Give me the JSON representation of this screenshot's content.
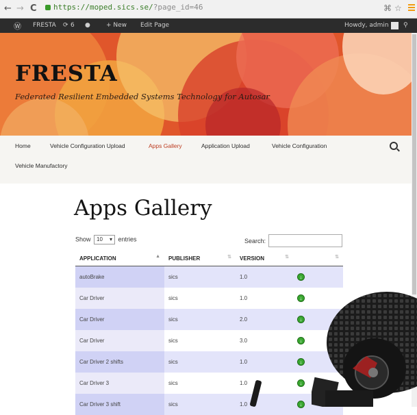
{
  "browser": {
    "back": "←",
    "forward": "→",
    "reload": "C",
    "url_host": "https://moped.sics.se/",
    "url_path": "?page_id=46"
  },
  "adminbar": {
    "site": "FRESTA",
    "updates": "6",
    "new": "+ New",
    "edit_page": "Edit Page",
    "greeting": "Howdy, admin"
  },
  "header": {
    "title": "FRESTA",
    "tagline": "Federated Resilient Embedded Systems Technology for Autosar"
  },
  "nav": {
    "items": [
      {
        "label": "Home"
      },
      {
        "label": "Vehicle Configuration Upload"
      },
      {
        "label": "Apps Gallery"
      },
      {
        "label": "Application Upload"
      },
      {
        "label": "Vehicle Configuration"
      },
      {
        "label": "Vehicle Manufactory"
      }
    ]
  },
  "main": {
    "title": "Apps Gallery",
    "show_label": "Show",
    "entries_value": "10",
    "entries_label": "entries",
    "search_label": "Search:",
    "search_value": "",
    "columns": [
      "APPLICATION",
      "PUBLISHER",
      "VERSION",
      ""
    ],
    "rows": [
      {
        "app": "autoBrake",
        "publisher": "sics",
        "version": "1.0"
      },
      {
        "app": "Car Driver",
        "publisher": "sics",
        "version": "1.0"
      },
      {
        "app": "Car Driver",
        "publisher": "sics",
        "version": "2.0"
      },
      {
        "app": "Car Driver",
        "publisher": "sics",
        "version": "3.0"
      },
      {
        "app": "Car Driver 2 shifts",
        "publisher": "sics",
        "version": "1.0"
      },
      {
        "app": "Car Driver 3",
        "publisher": "sics",
        "version": "1.0"
      },
      {
        "app": "Car Driver 3 shift",
        "publisher": "sics",
        "version": "1.0"
      }
    ]
  },
  "colors": {
    "banner": "#e0562b",
    "nav_active": "#bc3b1f",
    "row_odd": "#e3e4fa",
    "download_icon": "#3ba832"
  }
}
